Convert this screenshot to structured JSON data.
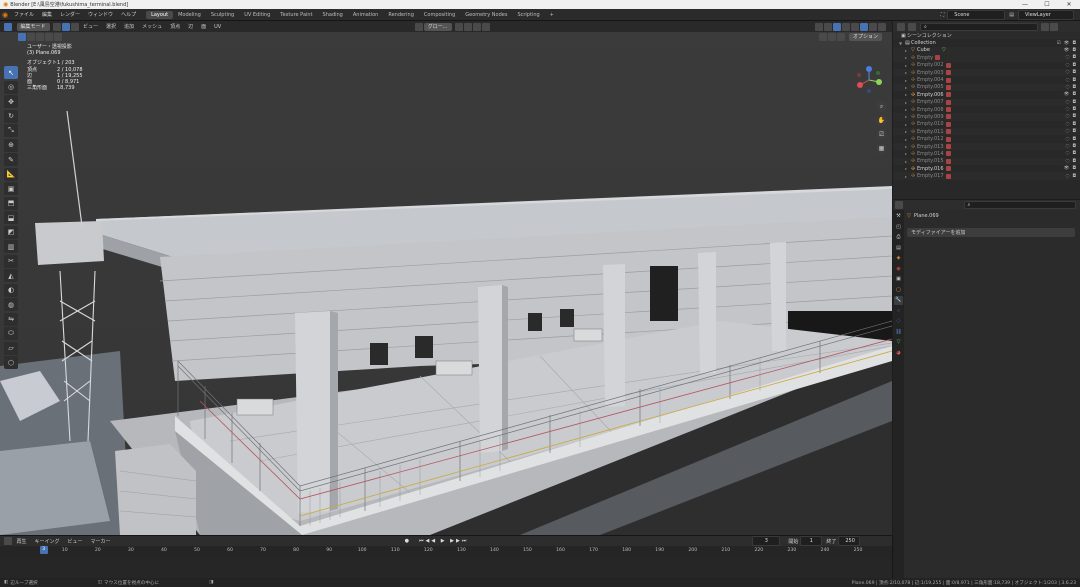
{
  "window": {
    "title": "Blender [E:\\風島空港\\fukushima_terminal.blend]",
    "controls": [
      "—",
      "☐",
      "✕"
    ]
  },
  "menubar": {
    "menus": [
      "ファイル",
      "編集",
      "レンダー",
      "ウィンドウ",
      "ヘルプ"
    ],
    "workspaces": [
      "Layout",
      "Modeling",
      "Sculpting",
      "UV Editing",
      "Texture Paint",
      "Shading",
      "Animation",
      "Rendering",
      "Compositing",
      "Geometry Nodes",
      "Scripting"
    ],
    "active_workspace": "Layout",
    "add_tab": "+",
    "scene": "Scene",
    "view_layer": "ViewLayer"
  },
  "viewport_header": {
    "mode": "編集モード",
    "menus": [
      "ビュー",
      "選択",
      "追加",
      "メッシュ",
      "頂点",
      "辺",
      "面",
      "UV"
    ],
    "transform_orientation": "グロー...",
    "options": "オプション"
  },
  "stats": {
    "view_name": "ユーザー・透視投影",
    "object_name": "(3) Plane.069",
    "rows": [
      {
        "k": "オブジェクト",
        "v": "1 / 203"
      },
      {
        "k": "頂点",
        "v": "2 / 10,078"
      },
      {
        "k": "辺",
        "v": "1 / 19,255"
      },
      {
        "k": "面",
        "v": "0 / 8,971"
      },
      {
        "k": "三角形面",
        "v": "18,739"
      }
    ]
  },
  "outliner": {
    "header": "シーンコレクション",
    "collection": "Collection",
    "cube": "Cube",
    "items": [
      "Empty",
      "Empty.002",
      "Empty.003",
      "Empty.004",
      "Empty.005",
      "Empty.006",
      "Empty.007",
      "Empty.008",
      "Empty.009",
      "Empty.010",
      "Empty.011",
      "Empty.012",
      "Empty.013",
      "Empty.014",
      "Empty.015",
      "Empty.016",
      "Empty.017"
    ],
    "bright_items": [
      "Empty.006",
      "Empty.016"
    ]
  },
  "properties": {
    "object": "Plane.069",
    "add_modifier": "モディファイアーを追加"
  },
  "timeline": {
    "menus": [
      "再生",
      "キーイング",
      "ビュー",
      "マーカー"
    ],
    "current_frame": "3",
    "start_label": "開始",
    "start": "1",
    "end_label": "終了",
    "end": "250",
    "ticks": [
      "1",
      "10",
      "20",
      "30",
      "40",
      "50",
      "60",
      "70",
      "80",
      "90",
      "100",
      "110",
      "120",
      "130",
      "140",
      "150",
      "160",
      "170",
      "180",
      "190",
      "200",
      "210",
      "220",
      "230",
      "240",
      "250"
    ],
    "playhead": "3"
  },
  "statusbar": {
    "left": "辺ループ選択",
    "middle": "マウス位置を視点の中心に",
    "right": "Plane.069 | 頂点:2/10,078 | 辺:1/19,255 | 面:0/8,971 | 三角形面:18,739 | オブジェクト:1/203 | 3.6.23"
  }
}
